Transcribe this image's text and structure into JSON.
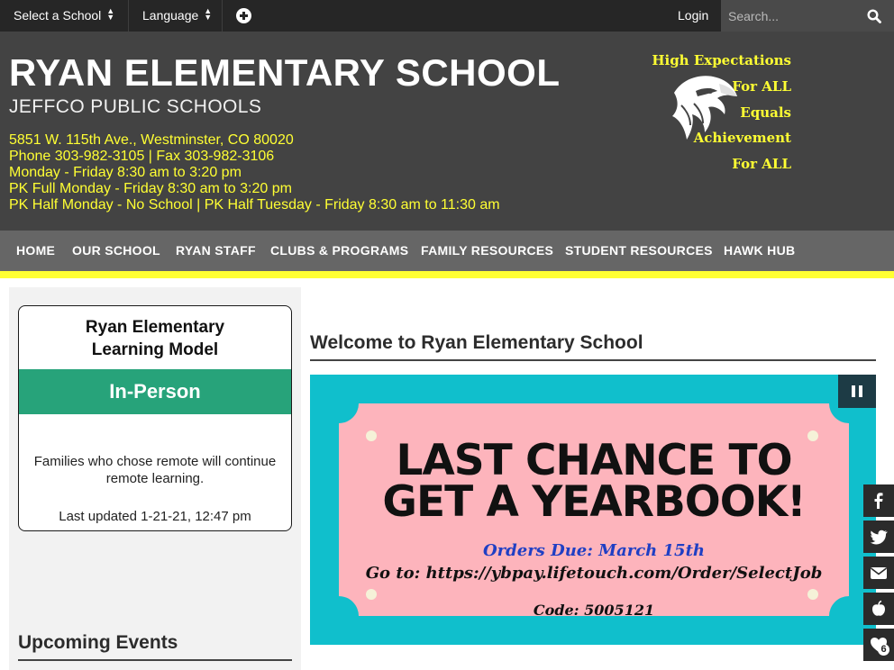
{
  "topbar": {
    "select_school": "Select a School",
    "language": "Language",
    "login": "Login",
    "search_placeholder": "Search..."
  },
  "header": {
    "school_name": "RYAN ELEMENTARY SCHOOL",
    "district": "JEFFCO PUBLIC SCHOOLS",
    "info_lines": [
      "5851 W. 115th Ave., Westminster, CO 80020",
      "Phone 303-982-3105 | Fax 303-982-3106",
      "Monday - Friday 8:30 am to 3:20 pm",
      "PK Full Monday - Friday 8:30 am to 3:20 pm",
      "PK Half Monday - No School | PK Half Tuesday - Friday 8:30 am to 11:30 am"
    ],
    "motto": [
      "High Expectations",
      "For ALL",
      "Equals",
      "Achievement",
      "For ALL"
    ],
    "accent_color": "#ffff33"
  },
  "nav": {
    "items": [
      "HOME",
      "OUR SCHOOL",
      "RYAN STAFF",
      "CLUBS & PROGRAMS",
      "FAMILY RESOURCES",
      "STUDENT RESOURCES",
      "HAWK HUB"
    ]
  },
  "learning_model": {
    "title_line1": "Ryan Elementary",
    "title_line2": "Learning Model",
    "status": "In-Person",
    "status_color": "#27a37a",
    "note_line1": "Families who chose remote will continue",
    "note_line2": "remote learning.",
    "updated": "Last updated 1-21-21, 12:47 pm"
  },
  "sidebar": {
    "upcoming_events": "Upcoming Events"
  },
  "main": {
    "welcome_title": "Welcome to Ryan Elementary School",
    "slide": {
      "headline_line1": "LAST CHANCE TO",
      "headline_line2": "GET A YEARBOOK!",
      "orders_due": "Orders Due: March 15th",
      "url_line": "Go to: https://ybpay.lifetouch.com/Order/SelectJob",
      "code": "Code: 5005121"
    }
  },
  "social": {
    "icons": [
      "facebook-icon",
      "twitter-icon",
      "email-icon",
      "apple-icon",
      "heart-icon"
    ],
    "like_count": "6"
  }
}
